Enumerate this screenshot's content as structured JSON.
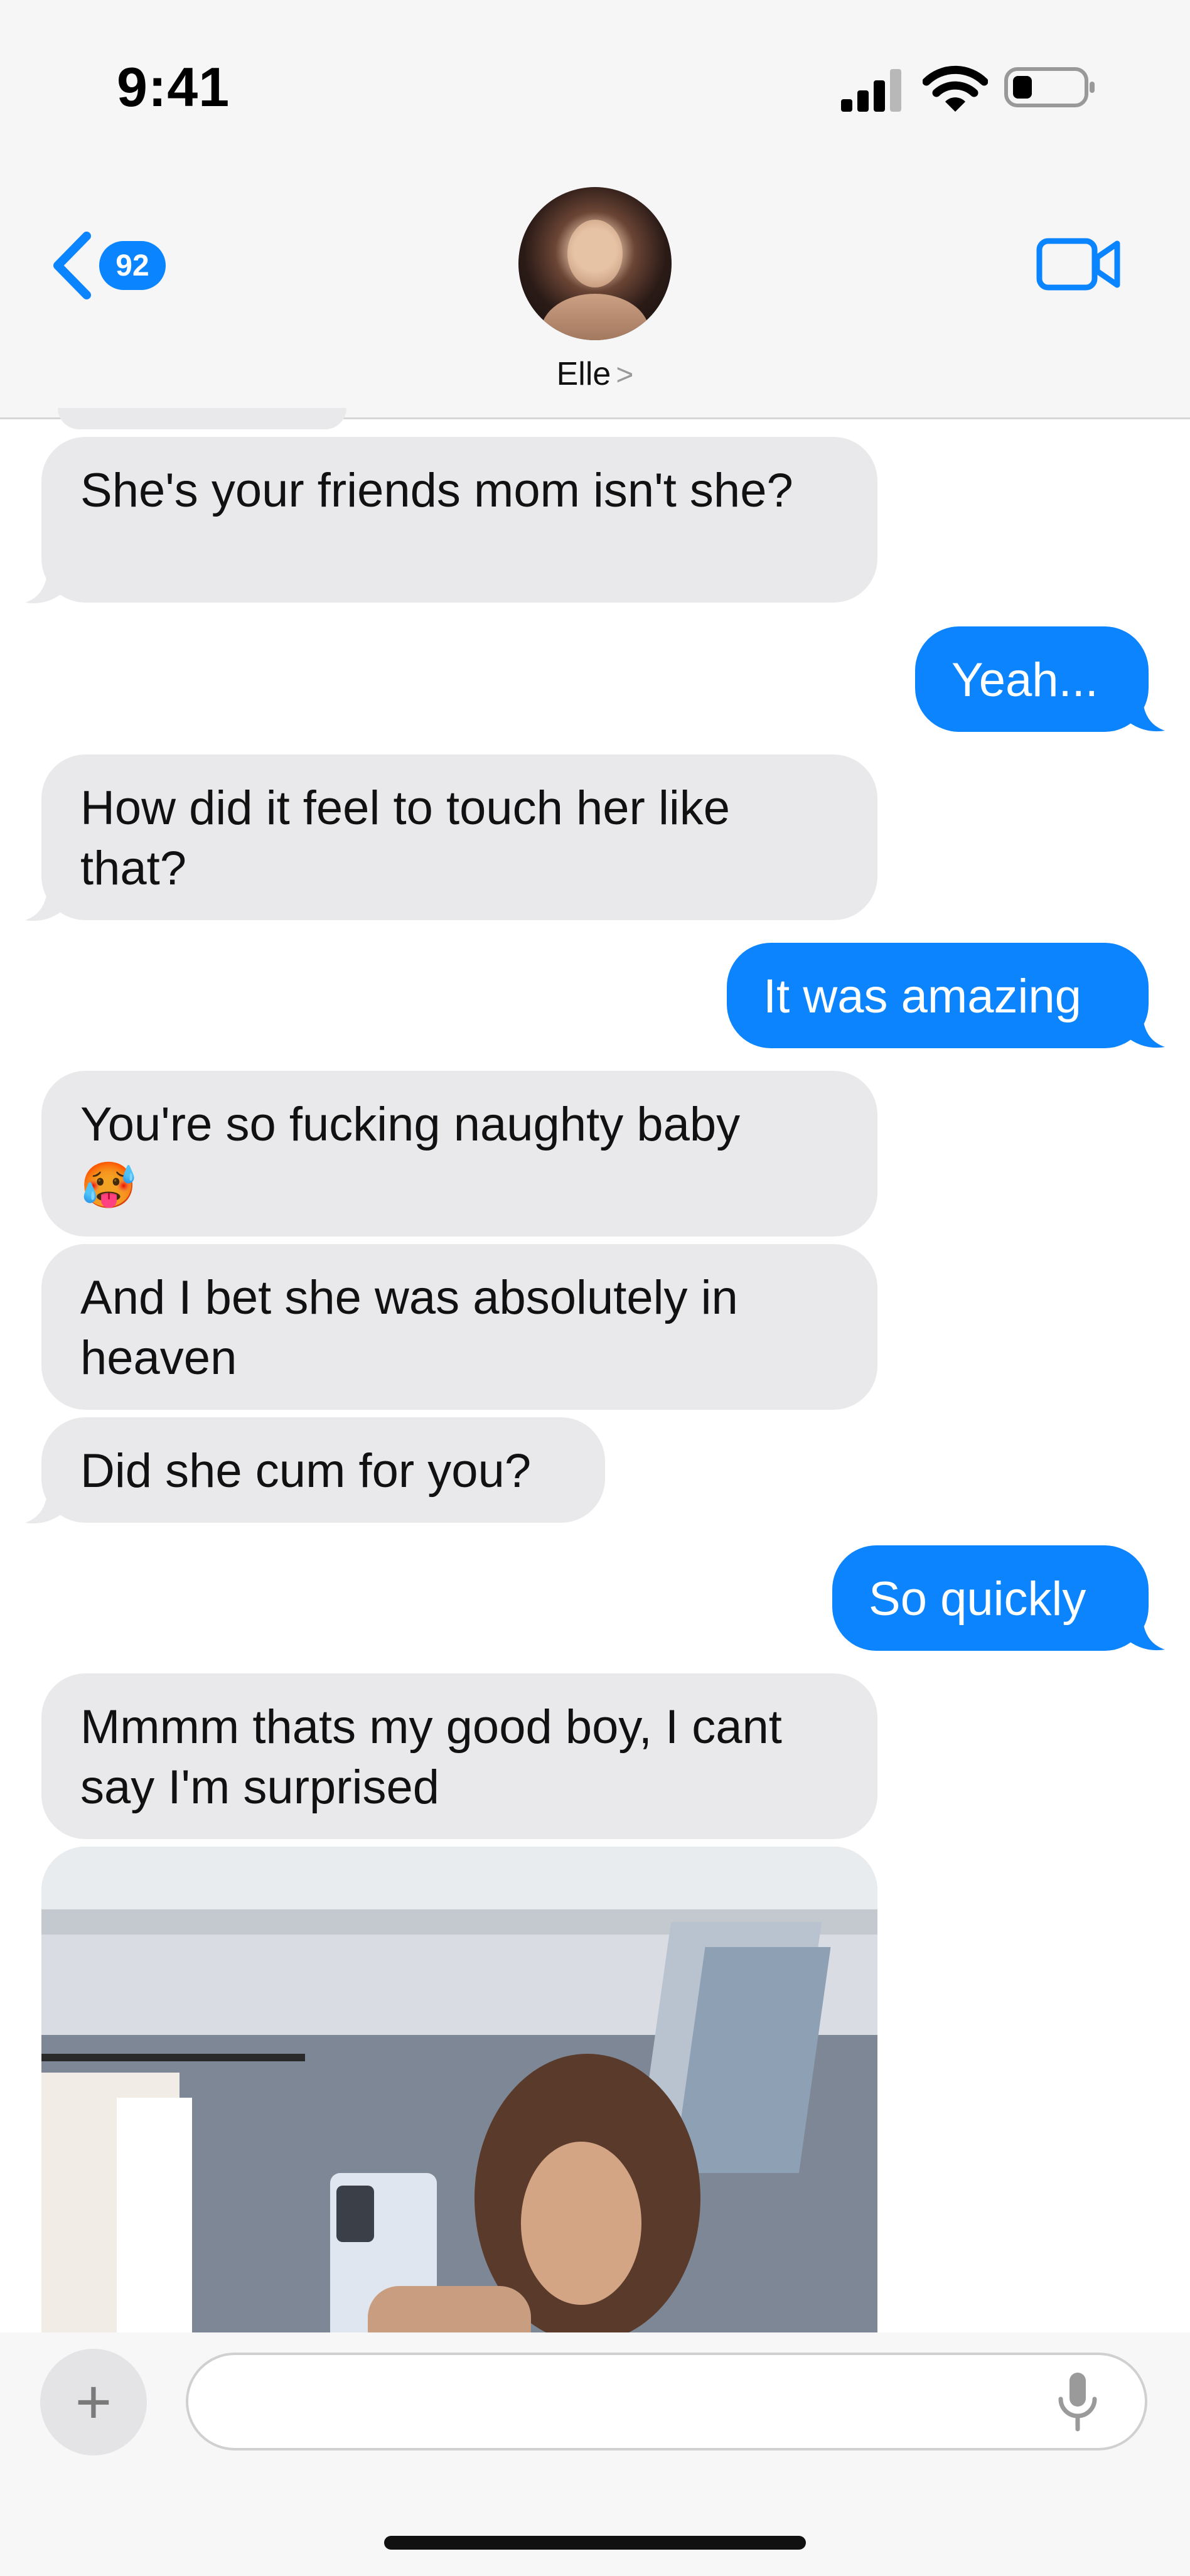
{
  "status_bar": {
    "time": "9:41"
  },
  "header": {
    "back_count": "92",
    "contact_name": "Elle",
    "name_chevron": ">"
  },
  "messages": [
    {
      "from": "them",
      "text": "She's your friends mom isn't she?"
    },
    {
      "from": "me",
      "text": "Yeah..."
    },
    {
      "from": "them",
      "text": "How did it feel to touch her like that?"
    },
    {
      "from": "me",
      "text": "It was amazing"
    },
    {
      "from": "them",
      "text": "You're so fucking naughty baby"
    },
    {
      "from": "them",
      "text": "And I bet she was absolutely in heaven"
    },
    {
      "from": "them",
      "text": "Did she cum for you?"
    },
    {
      "from": "me",
      "text": "So quickly"
    },
    {
      "from": "them",
      "text": "Mmmm thats my good boy, I cant say I'm surprised"
    }
  ],
  "emoji": {
    "hot_face": "🥵"
  },
  "composer": {
    "plus": "+",
    "placeholder": ""
  },
  "icons": {
    "back": "chevron-left-icon",
    "video": "video-camera-icon",
    "mic": "microphone-icon",
    "signal": "cellular-signal-icon",
    "wifi": "wifi-icon",
    "battery": "battery-icon"
  },
  "colors": {
    "accent": "#0b84fe",
    "incoming_bubble": "#e9e9eb",
    "header_bg": "#f6f6f6"
  }
}
